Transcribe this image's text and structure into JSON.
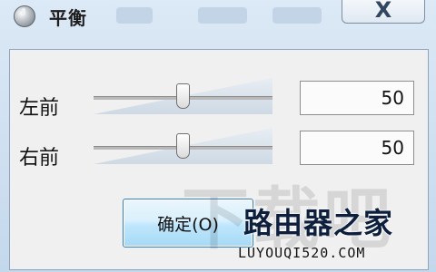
{
  "window": {
    "title": "平衡",
    "close_label": "X"
  },
  "balance": {
    "rows": [
      {
        "label": "左前",
        "value": "50",
        "level_percent": 50
      },
      {
        "label": "右前",
        "value": "50",
        "level_percent": 50
      }
    ]
  },
  "buttons": {
    "ok_label": "确定(O)"
  },
  "watermark": {
    "big_text": "下载吧",
    "brand_cn": "路由器之家",
    "brand_en": "LUYOUQI520.COM"
  },
  "icons": {
    "app": "speaker-icon",
    "close": "close-icon"
  }
}
